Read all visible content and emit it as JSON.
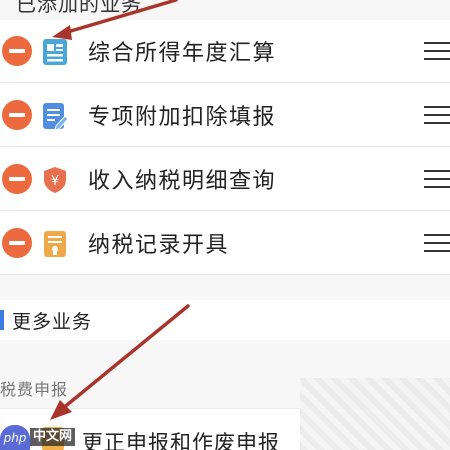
{
  "top_section": {
    "label": "已添加的业务"
  },
  "rows": [
    {
      "label": "综合所得年度汇算",
      "icon": "annual-settlement-doc-icon",
      "icon_color": "#4aa6d8"
    },
    {
      "label": "专项附加扣除填报",
      "icon": "deduction-form-edit-icon",
      "icon_color": "#4f8ee0"
    },
    {
      "label": "收入纳税明细查询",
      "icon": "yuan-shield-icon",
      "icon_color": "#e8704f"
    },
    {
      "label": "纳税记录开具",
      "icon": "tax-record-certificate-icon",
      "icon_color": "#f0a94a"
    }
  ],
  "more_section": {
    "title": "更多业务",
    "subsection": "税费申报",
    "first_item": {
      "label": "更正申报和作废申报",
      "icon": "correction-report-icon"
    }
  },
  "watermark": {
    "logo": "php",
    "text": "中文网"
  },
  "colors": {
    "remove_button": "#ec6a3e",
    "section_accent": "#3b7de0",
    "annotation_arrow": "#a8352c"
  }
}
